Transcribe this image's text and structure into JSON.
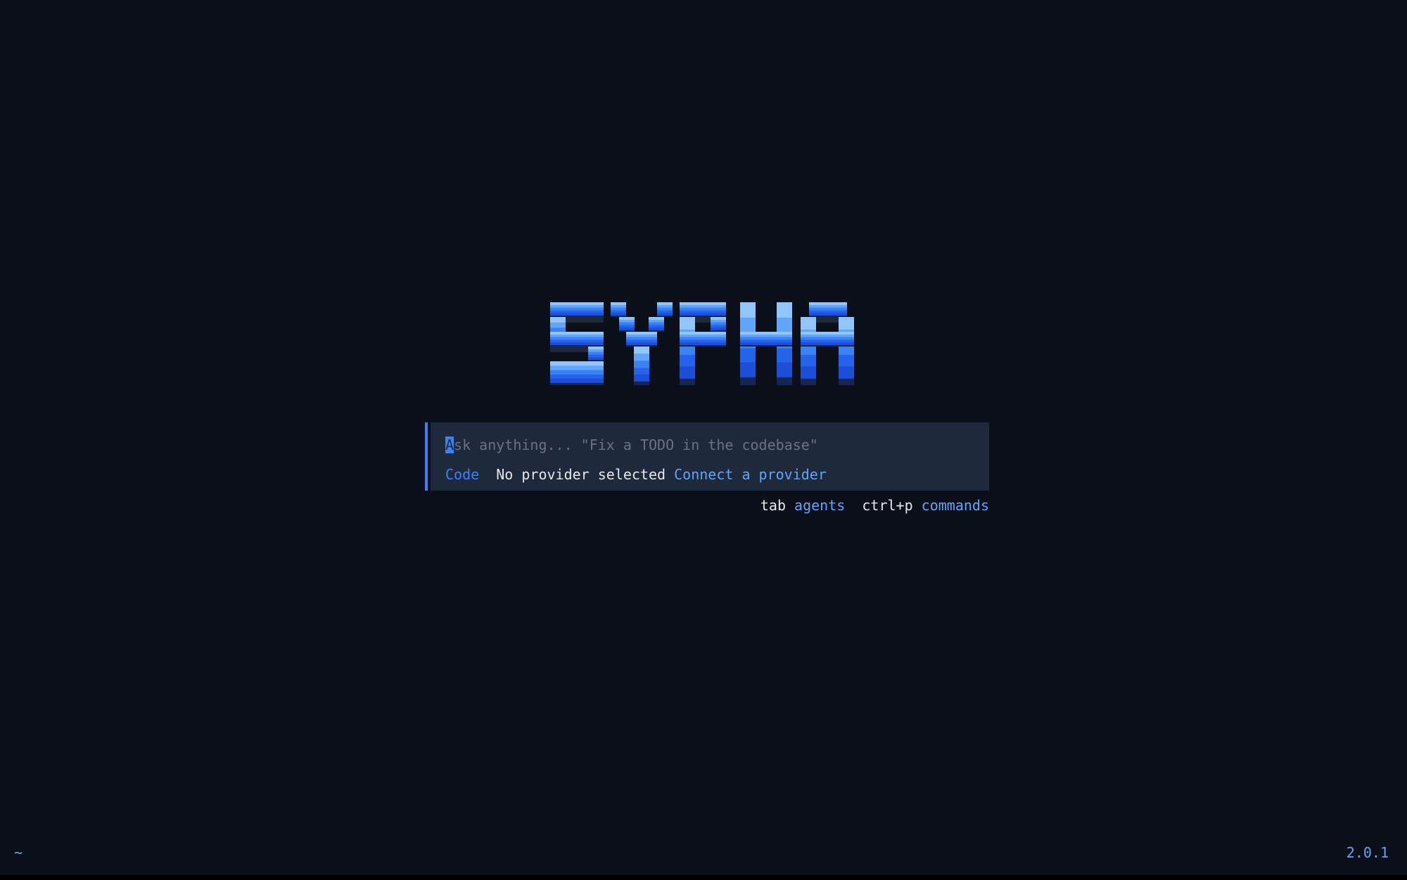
{
  "app": {
    "logo_text": "SYPHA"
  },
  "prompt": {
    "placeholder_first_char": "A",
    "placeholder_rest": "sk anything... \"Fix a TODO in the codebase\""
  },
  "status": {
    "mode": "Code",
    "provider_status": "No provider selected",
    "connect_link": "Connect a provider"
  },
  "hints": {
    "agents_key": "tab",
    "agents_label": "agents",
    "commands_key": "ctrl+p",
    "commands_label": "commands"
  },
  "footer": {
    "cwd": "~",
    "version": "2.0.1"
  },
  "colors": {
    "background": "#0b0f19",
    "panel": "#1e293b",
    "accent": "#3b82f6",
    "link": "#60a5fa",
    "logo_gradient": [
      "#93c5fd",
      "#60a5fa",
      "#3b82f6",
      "#2563eb",
      "#1d4ed8"
    ]
  }
}
